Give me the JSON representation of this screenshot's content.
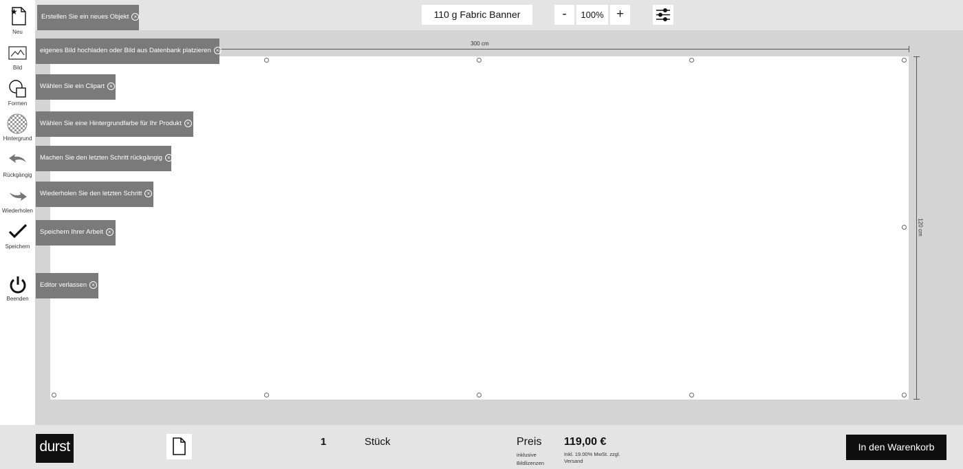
{
  "toolbar": {
    "product_name": "110 g Fabric Banner",
    "zoom_minus": "-",
    "zoom_value": "100%",
    "zoom_plus": "+"
  },
  "sidebar": {
    "new": "Neu",
    "image": "Bild",
    "shapes": "Formen",
    "background": "Hintergrund",
    "undo": "Rückgängig",
    "redo": "Wiederholen",
    "save": "Speichern",
    "exit": "Beenden"
  },
  "tooltips": {
    "new": "Erstellen Sie ein neues Objekt",
    "image": "eigenes Bild hochladen oder Bild aus Datenbank platzieren",
    "clipart": "Wählen Sie ein Clipart",
    "background": "Wählen Sie eine Hintergrundfarbe für Ihr Produkt",
    "undo": "Machen Sie den letzten Schritt rückgängig",
    "redo": "Wiederholen Sie den letzten Schritt",
    "save": "Speichern Ihrer Arbeit",
    "exit": "Editor verlassen",
    "close_glyph": "×"
  },
  "canvas": {
    "width_label": "300 cm",
    "height_label": "120 cm"
  },
  "footer": {
    "logo": "durst",
    "quantity": "1",
    "unit": "Stück",
    "price_label": "Preis",
    "price_label_sub": "inklusive Bildlizenzen",
    "price": "119,00 €",
    "price_sub": "Inkl. 19.00% MwSt. zzgl. Versand",
    "cart_button": "In den Warenkorb"
  }
}
